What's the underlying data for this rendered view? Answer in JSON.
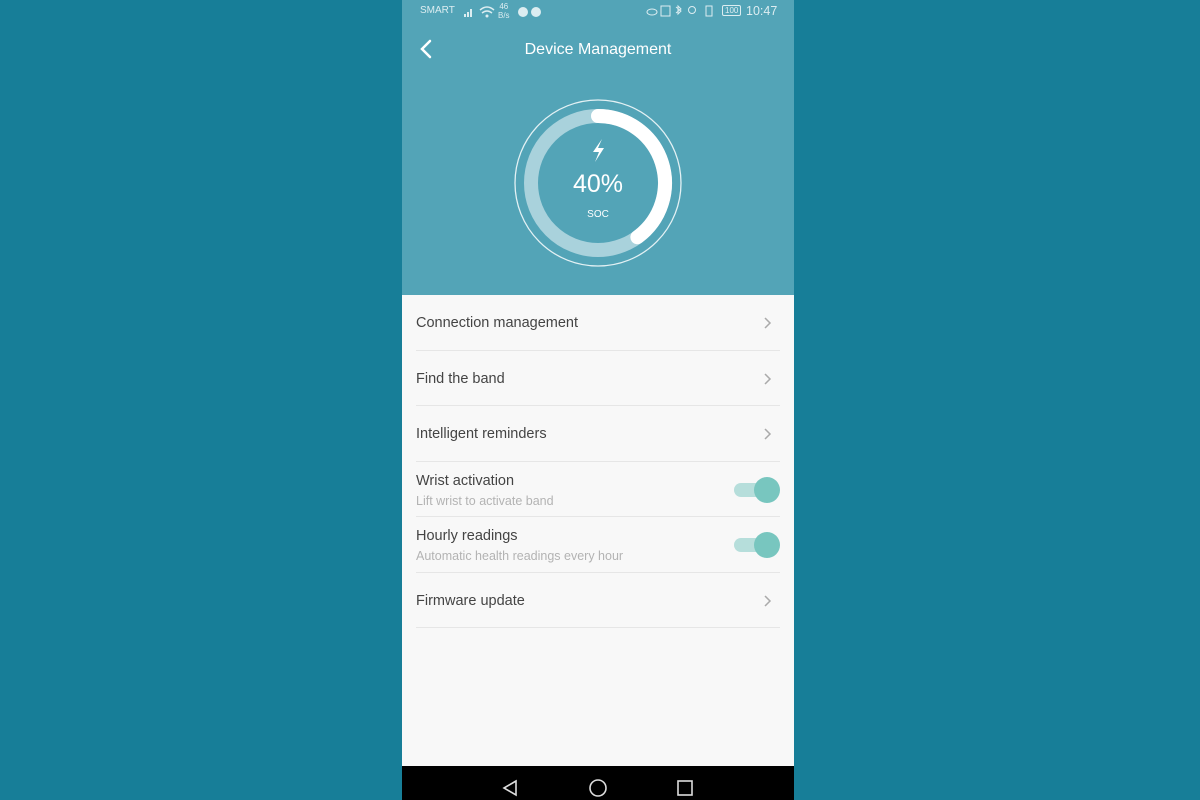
{
  "status_bar": {
    "carrier": "SMART",
    "net_speed_value": "46",
    "net_speed_unit": "B/s",
    "battery": "100",
    "time": "10:47"
  },
  "header": {
    "title": "Device Management"
  },
  "battery_gauge": {
    "percent_label": "40%",
    "percent": 40,
    "label": "SOC",
    "icon": "lightning-bolt-icon"
  },
  "items": [
    {
      "title": "Connection management",
      "type": "link"
    },
    {
      "title": "Find the band",
      "type": "link"
    },
    {
      "title": "Intelligent reminders",
      "type": "link"
    },
    {
      "title": "Wrist activation",
      "subtitle": "Lift wrist to activate band",
      "type": "toggle",
      "on": true
    },
    {
      "title": "Hourly readings",
      "subtitle": "Automatic health readings every hour",
      "type": "toggle",
      "on": true
    },
    {
      "title": "Firmware update",
      "type": "link"
    }
  ],
  "colors": {
    "header": "#53a4b7",
    "background": "#177e98",
    "toggle_on": "#78c6bf"
  }
}
